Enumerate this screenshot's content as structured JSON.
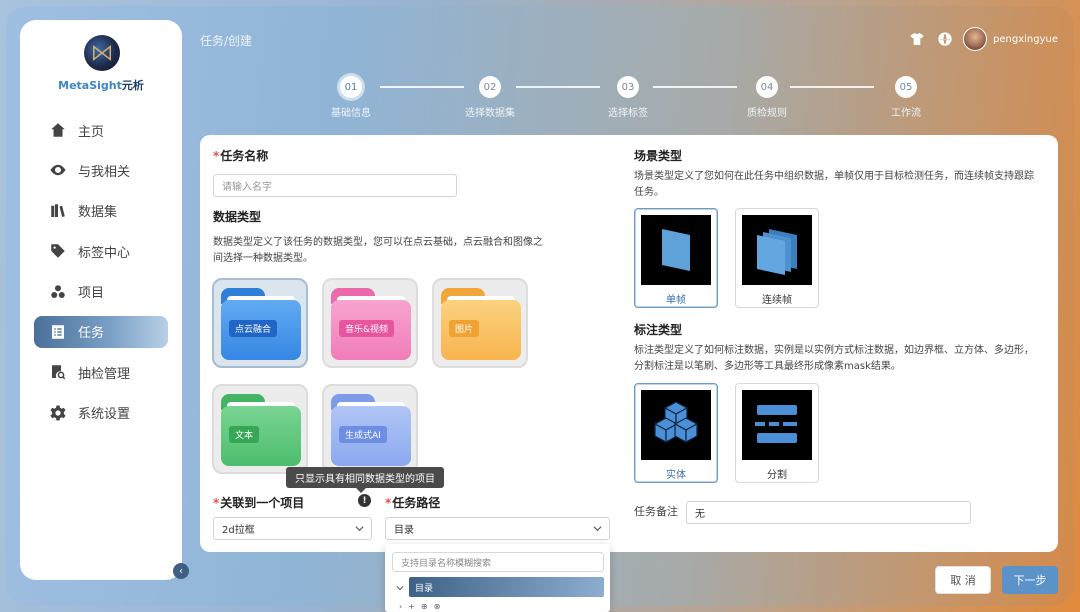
{
  "brand": {
    "name_prefix": "MetaSight",
    "name_suffix": "元析"
  },
  "sidebar": {
    "items": [
      {
        "label": "主页",
        "icon": "home-icon"
      },
      {
        "label": "与我相关",
        "icon": "eye-icon"
      },
      {
        "label": "数据集",
        "icon": "books-icon"
      },
      {
        "label": "标签中心",
        "icon": "tag-icon"
      },
      {
        "label": "项目",
        "icon": "cubes-icon"
      },
      {
        "label": "任务",
        "icon": "task-list-icon",
        "active": true
      },
      {
        "label": "抽检管理",
        "icon": "inspect-icon"
      },
      {
        "label": "系统设置",
        "icon": "gear-icon"
      }
    ],
    "collapse_icon": "‹"
  },
  "header": {
    "breadcrumb": "任务/创建",
    "username": "pengxingyue",
    "icons": [
      "shirt-icon",
      "globe-icon"
    ]
  },
  "steps": [
    {
      "num": "01",
      "label": "基础信息",
      "active": true
    },
    {
      "num": "02",
      "label": "选择数据集"
    },
    {
      "num": "03",
      "label": "选择标签"
    },
    {
      "num": "04",
      "label": "质检规则"
    },
    {
      "num": "05",
      "label": "工作流"
    }
  ],
  "form": {
    "task_name": {
      "label": "任务名称",
      "placeholder": "请输入名字"
    },
    "data_type": {
      "title": "数据类型",
      "description_line1": "数据类型定义了该任务的数据类型，您可以在点云基础，点云融合和图像之",
      "description_line2": "间选择一种数据类型。",
      "options": [
        {
          "label": "点云融合",
          "color": "#3d8fe6",
          "selected": true
        },
        {
          "label": "音乐&视频",
          "color": "#ef79b6"
        },
        {
          "label": "图片",
          "color": "#f6b24d"
        },
        {
          "label": "文本",
          "color": "#4fbf6b"
        },
        {
          "label": "生成式AI",
          "color": "#8aa7ef"
        }
      ]
    },
    "tooltip": "只显示具有相同数据类型的项目",
    "project": {
      "label": "关联到一个项目",
      "value": "2d拉框"
    },
    "task_path": {
      "label": "任务路径",
      "value": "目录"
    },
    "path_dropdown": {
      "search_placeholder": "支持目录名称模糊搜索",
      "node": "目录"
    },
    "scene_type": {
      "title": "场景类型",
      "description_line1": "场景类型定义了您如何在此任务中组织数据，单帧仅用于目标检测任务，而连续帧支持跟踪",
      "description_line2": "任务。",
      "options": [
        {
          "label": "单帧",
          "selected": true
        },
        {
          "label": "连续帧"
        }
      ]
    },
    "annotation_type": {
      "title": "标注类型",
      "description_line1": "标注类型定义了如何标注数据，实例是以实例方式标注数据，如边界框、立方体、多边形，",
      "description_line2": "分割标注是以笔刷、多边形等工具最终形成像素mask结果。",
      "options": [
        {
          "label": "实体",
          "selected": true
        },
        {
          "label": "分割"
        }
      ]
    },
    "task_note": {
      "label": "任务备注",
      "value": "无"
    }
  },
  "footer": {
    "cancel_label": "取 消",
    "next_label": "下一步"
  },
  "colors": {
    "accent": "#5b93c9",
    "active_nav": "#4a6f9a",
    "required": "#e84d4d"
  }
}
